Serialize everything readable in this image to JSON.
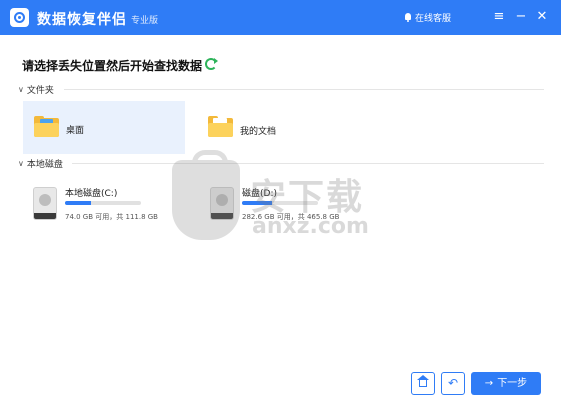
{
  "titlebar": {
    "app_title": "数据恢复伴侣",
    "edition": "专业版",
    "service_label": "在线客服",
    "menu_icon": "≡",
    "minimize_icon": "−",
    "close_icon": "✕"
  },
  "main": {
    "heading": "请选择丢失位置然后开始查找数据"
  },
  "folders_section": {
    "title": "文件夹",
    "items": [
      {
        "label": "桌面",
        "icon": "desktop-folder-icon",
        "selected": true
      },
      {
        "label": "我的文档",
        "icon": "documents-folder-icon",
        "selected": false
      }
    ]
  },
  "disks_section": {
    "title": "本地磁盘",
    "items": [
      {
        "name": "本地磁盘(C:)",
        "space": "74.0 GB 可用，共 111.8 GB",
        "used_fraction": 0.34
      },
      {
        "name": "磁盘(D:)",
        "space": "282.6 GB 可用，共 465.8 GB",
        "used_fraction": 0.39
      }
    ]
  },
  "watermark": {
    "cn": "安下载",
    "en": "anxz.com"
  },
  "footer": {
    "next_label": "下一步",
    "next_arrow": "→",
    "back_glyph": "↶"
  },
  "colors": {
    "accent": "#2f7cf6",
    "refresh": "#2db35a",
    "selected_bg": "#e9f1fd"
  }
}
